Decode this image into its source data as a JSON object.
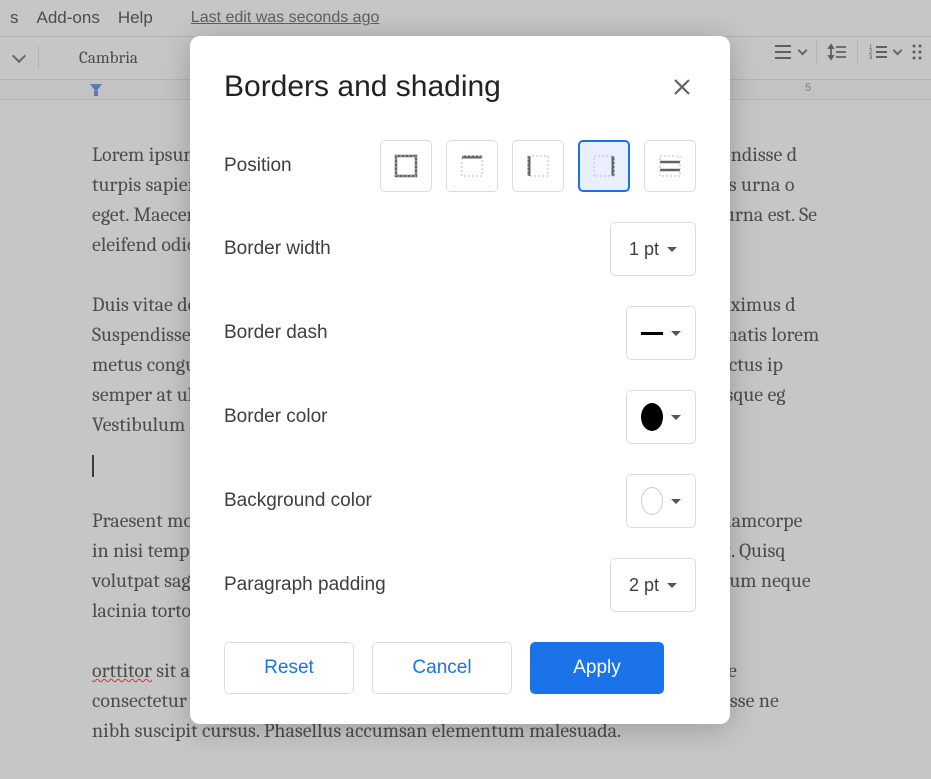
{
  "menubar": {
    "items": [
      "s",
      "Add-ons",
      "Help"
    ],
    "edit_status": "Last edit was seconds ago"
  },
  "toolbar": {
    "font": "Cambria"
  },
  "ruler": {
    "visible_number": "5"
  },
  "document": {
    "p1": "Lorem ipsum dolor sit amet, consectetur adipiscing elit. Nam vel mauris. Suspendisse d\nturpis sapien, vehicula ac enim quis, scelerisque maximus sem. Etiam, eu mollis urna o\neget. Maecenas convallis augue mattis mattis consequat. Vivamus ac faucibus urna est. Se\neleifend odio faucibus hendrerit.",
    "p2": "Duis vitae dolor neque. Sed facilisis rutrum laoreet. Donec pellentesque nec maximus d\nSuspendisse et erat ipsum. Integer vulputate dui in lacinia efficitur. Proin venenatis lorem\nmetus congue, velit sit amet faucibus fringilla magna condimentum. Nullam lectus ip\nsemper at ultrices vitae, lacinia eu diam. Nunc hendrerit sagittis ante. Pellentesque eg\nVestibulum condimentum venenatis erat.",
    "p3": "Praesent molestie vitae tortor ac porttitor. Morbi vel mauris leo. Vestibulum ullamcorpe\nin nisi tempor gravida. Mauris id consequat nisl, sit amet pulvinar facilisis erat. Quisq\nvolutpat sagittis. Vivamus feugiat risus elit, vitae efficitur eget id  ana non, rutrum neque\nlacinia tortor rutrum, tincidunt ante vel, luctus nulla.",
    "p4a": "orttitor",
    "p4b": " sit amet elit sit amet, feugiat efficitur augue. Lorem ipsum dolor sit ame\nconsectetur nisl. Aliquam ut efficitur nisi. Nunc posuere lobortis nisi. Suspendisse ne\nnibh suscipit cursus. Phasellus accumsan elementum malesuada."
  },
  "dialog": {
    "title": "Borders and shading",
    "labels": {
      "position": "Position",
      "border_width": "Border width",
      "border_dash": "Border dash",
      "border_color": "Border color",
      "background_color": "Background color",
      "paragraph_padding": "Paragraph padding"
    },
    "values": {
      "border_width": "1 pt",
      "paragraph_padding": "2 pt",
      "border_color": "#000000",
      "background_color": "none",
      "selected_position_index": 3
    },
    "actions": {
      "reset": "Reset",
      "cancel": "Cancel",
      "apply": "Apply"
    }
  }
}
